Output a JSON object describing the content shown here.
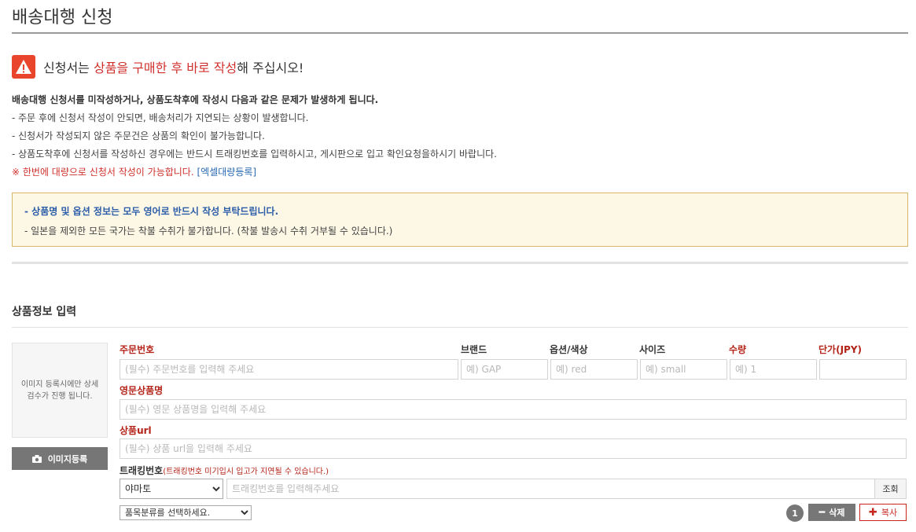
{
  "page": {
    "title": "배송대행 신청"
  },
  "warning": {
    "prefix": "신청서는 ",
    "highlight": "상품을 구매한 후 바로 작성",
    "suffix": "해 주십시오!"
  },
  "notice": {
    "heading": "배송대행 신청서를 미작성하거나, 상품도착후에 작성시 다음과 같은 문제가 발생하게 됩니다.",
    "items": [
      "- 주문 후에 신청서 작성이 안되면, 배송처리가 지연되는 상황이 발생합니다.",
      "- 신청서가 작성되지 않은 주문건은 상품의 확인이 불가능합니다.",
      "- 상품도착후에 신청서를 작성하신 경우에는 반드시 트래킹번호를 입력하시고, 게시판으로 입고 확인요청을하시기 바랍니다."
    ],
    "bulk_text": "※ 한번에 대량으로 신청서 작성이 가능합니다.",
    "bulk_link": "[엑셀대량등록]"
  },
  "info_box": {
    "line1": "- 상품명 및 옵션 정보는 모두 영어로 반드시 작성 부탁드립니다.",
    "line2": "- 일본을 제외한 모든 국가는 착불 수취가 불가합니다. (착불 발송시 수취 거부될 수 있습니다.)"
  },
  "section": {
    "title": "상품정보 입력"
  },
  "image": {
    "note": "이미지 등록시에만 상세 검수가 진행 됩니다.",
    "button": "이미지등록"
  },
  "form": {
    "order_no": {
      "label": "주문번호",
      "placeholder": "(필수) 주문번호를 입력해 주세요"
    },
    "brand": {
      "label": "브랜드",
      "placeholder": "예) GAP"
    },
    "option": {
      "label": "옵션/색상",
      "placeholder": "예) red"
    },
    "size": {
      "label": "사이즈",
      "placeholder": "예) small"
    },
    "qty": {
      "label": "수량",
      "placeholder": "예) 1"
    },
    "price": {
      "label": "단가(JPY)",
      "placeholder": ""
    },
    "name_en": {
      "label": "영문상품명",
      "placeholder": "(필수) 영문 상품명을 입력해 주세요"
    },
    "url": {
      "label": "상품url",
      "placeholder": "(필수) 상품 url을 입력해 주세요"
    },
    "tracking": {
      "label": "트래킹번호",
      "sub": "(트래킹번호 미기입시 입고가 지연될 수 있습니다.)",
      "carrier": "야마토",
      "placeholder": "트래킹번호를 입력해주세요",
      "lookup": "조회"
    },
    "category": {
      "selected": "품목분류를 선택하세요."
    }
  },
  "actions": {
    "count": "1",
    "delete": "삭제",
    "copy": "복사"
  },
  "colors": {
    "accent_red": "#d0312d",
    "link_blue": "#2a6ab4",
    "warning_bg": "#e8452c"
  }
}
